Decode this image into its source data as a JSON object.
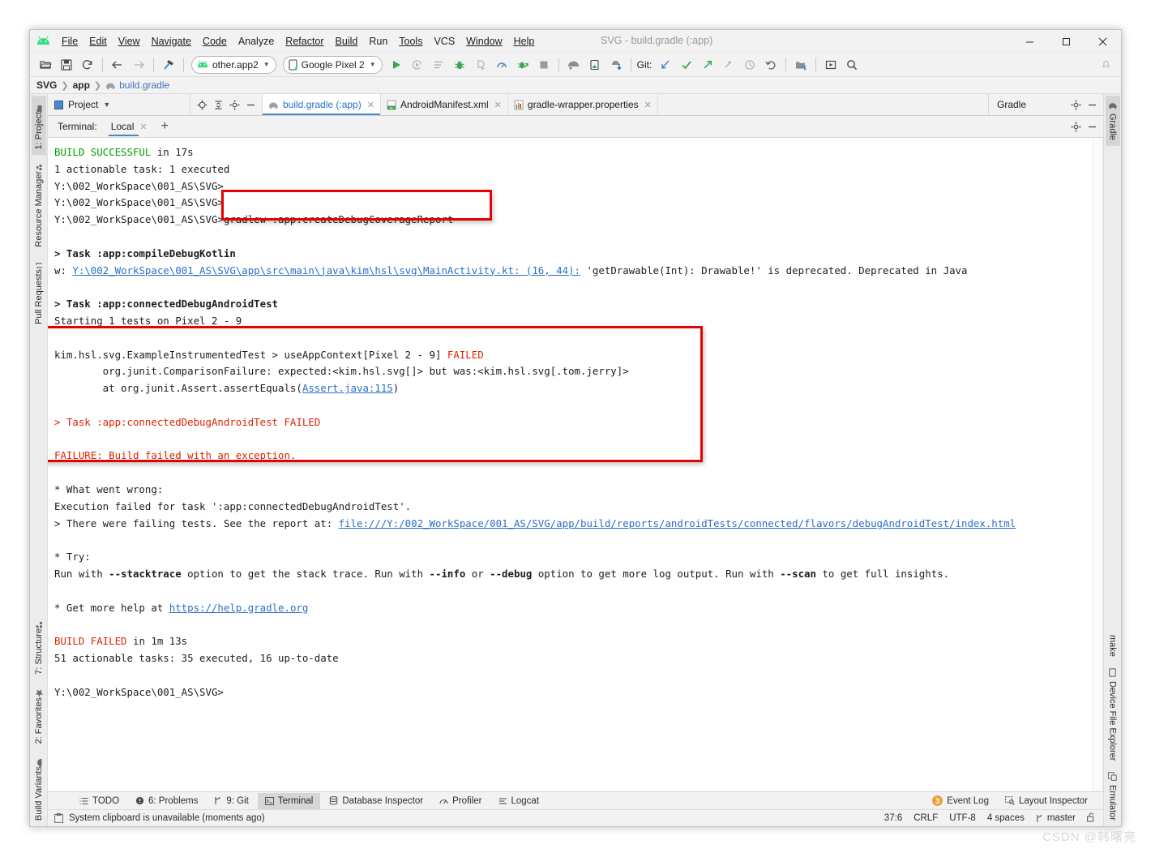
{
  "window": {
    "title": "SVG - build.gradle (:app)",
    "minimize": "–",
    "maximize": "☐",
    "close": "✕"
  },
  "menubar": {
    "items": [
      {
        "label": "File",
        "mnemonic": "F"
      },
      {
        "label": "Edit",
        "mnemonic": "E"
      },
      {
        "label": "View",
        "mnemonic": "V"
      },
      {
        "label": "Navigate",
        "mnemonic": "N"
      },
      {
        "label": "Code",
        "mnemonic": "C"
      },
      {
        "label": "Analyze",
        "mnemonic": "z"
      },
      {
        "label": "Refactor",
        "mnemonic": "R"
      },
      {
        "label": "Build",
        "mnemonic": "B"
      },
      {
        "label": "Run",
        "mnemonic": "u"
      },
      {
        "label": "Tools",
        "mnemonic": "T"
      },
      {
        "label": "VCS",
        "mnemonic": "S"
      },
      {
        "label": "Window",
        "mnemonic": "W"
      },
      {
        "label": "Help",
        "mnemonic": "H"
      }
    ]
  },
  "toolbar": {
    "module_combo": "other.app2",
    "device_combo": "Google Pixel 2",
    "git_label": "Git:",
    "icons": [
      "open-folder-icon",
      "save-all-icon",
      "sync-icon",
      "back-arrow-icon",
      "forward-arrow-icon",
      "build-hammer-icon"
    ],
    "run_icons": [
      "run-icon",
      "apply-changes-icon",
      "run-with-coverage-icon",
      "debug-icon",
      "attach-debugger-icon",
      "profiler-icon",
      "apply-code-changes-icon",
      "stop-icon"
    ],
    "device_icons": [
      "avd-manager-icon",
      "sdk-manager-icon",
      "device-file-explorer-icon"
    ],
    "git_icons": [
      "update-project-icon",
      "commit-icon",
      "push-icon",
      "revert-icon",
      "history-icon",
      "undo-icon"
    ],
    "right_icons": [
      "project-structure-icon",
      "layout-editor-icon",
      "search-everywhere-icon"
    ]
  },
  "breadcrumb": {
    "root": "SVG",
    "module": "app",
    "file": "build.gradle"
  },
  "project_panel": {
    "label": "Project",
    "caret": "▾",
    "buttons": [
      "locate-icon",
      "collapse-all-icon",
      "settings-gear-icon",
      "hide-icon"
    ]
  },
  "editor_tabs": [
    {
      "label": "build.gradle (:app)",
      "icon": "gradle-elephant-icon",
      "active": true,
      "close": "✕"
    },
    {
      "label": "AndroidManifest.xml",
      "icon": "manifest-file-icon",
      "active": false,
      "close": "✕"
    },
    {
      "label": "gradle-wrapper.properties",
      "icon": "properties-file-icon",
      "active": false,
      "close": "✕"
    }
  ],
  "gradle_panel": {
    "title": "Gradle",
    "buttons": [
      "settings-gear-icon",
      "hide-icon"
    ]
  },
  "left_stripe": {
    "top": [
      {
        "label": "1: Project",
        "icon": "project-folder-icon",
        "selected": true
      },
      {
        "label": "Resource Manager",
        "icon": "resource-manager-icon",
        "selected": false
      },
      {
        "label": "Pull Requests",
        "icon": "pull-request-icon",
        "selected": false
      }
    ],
    "bottom": [
      {
        "label": "7: Structure",
        "icon": "structure-icon",
        "selected": false
      },
      {
        "label": "2: Favorites",
        "icon": "star-icon",
        "selected": false
      },
      {
        "label": "Build Variants",
        "icon": "android-icon",
        "selected": false
      }
    ]
  },
  "right_stripe": {
    "top": [
      {
        "label": "Gradle",
        "icon": "gradle-elephant-icon",
        "selected": true
      }
    ],
    "bottom": [
      {
        "label": "make",
        "icon": "",
        "selected": false
      },
      {
        "label": "Device File Explorer",
        "icon": "device-icon",
        "selected": false
      },
      {
        "label": "Emulator",
        "icon": "emulator-icon",
        "selected": false
      }
    ]
  },
  "terminal": {
    "label": "Terminal:",
    "tab": "Local",
    "tab_close": "✕",
    "add": "+",
    "header_buttons": [
      "settings-gear-icon",
      "hide-icon"
    ],
    "lines": [
      [
        {
          "t": "BUILD SUCCESSFUL",
          "c": "g"
        },
        {
          "t": " in 17s"
        }
      ],
      [
        {
          "t": "1 actionable task: 1 executed"
        }
      ],
      [
        {
          "t": "Y:\\002_WorkSpace\\001_AS\\SVG>"
        }
      ],
      [
        {
          "t": "Y:\\002_WorkSpace\\001_AS\\SVG>"
        }
      ],
      [
        {
          "t": "Y:\\002_WorkSpace\\001_AS\\SVG>gradlew :app:createDebugCoverageReport"
        }
      ],
      [
        {
          "t": ""
        }
      ],
      [
        {
          "t": "> Task :app:compileDebugKotlin",
          "c": "b"
        }
      ],
      [
        {
          "t": "w: "
        },
        {
          "t": "Y:\\002_WorkSpace\\001_AS\\SVG\\app\\src\\main\\java\\kim\\hsl\\svg\\MainActivity.kt: (16, 44):",
          "c": "lnk"
        },
        {
          "t": " 'getDrawable(Int): Drawable!' is deprecated. Deprecated in Java"
        }
      ],
      [
        {
          "t": ""
        }
      ],
      [
        {
          "t": "> Task :app:connectedDebugAndroidTest",
          "c": "b"
        }
      ],
      [
        {
          "t": "Starting 1 tests on Pixel 2 - 9"
        }
      ],
      [
        {
          "t": ""
        }
      ],
      [
        {
          "t": "kim.hsl.svg.ExampleInstrumentedTest > useAppContext[Pixel 2 - 9] "
        },
        {
          "t": "FAILED",
          "c": "r"
        }
      ],
      [
        {
          "t": "        org.junit.ComparisonFailure: expected:<kim.hsl.svg[]> but was:<kim.hsl.svg[.tom.jerry]>"
        }
      ],
      [
        {
          "t": "        at org.junit.Assert.assertEquals("
        },
        {
          "t": "Assert.java:115",
          "c": "lnk"
        },
        {
          "t": ")"
        }
      ],
      [
        {
          "t": ""
        }
      ],
      [
        {
          "t": "> Task :app:connectedDebugAndroidTest FAILED",
          "c": "r"
        }
      ],
      [
        {
          "t": ""
        }
      ],
      [
        {
          "t": "FAILURE: Build failed with an exception.",
          "c": "r"
        }
      ],
      [
        {
          "t": ""
        }
      ],
      [
        {
          "t": "* What went wrong:"
        }
      ],
      [
        {
          "t": "Execution failed for task ':app:connectedDebugAndroidTest'."
        }
      ],
      [
        {
          "t": "> There were failing tests. See the report at: "
        },
        {
          "t": "file:///Y:/002_WorkSpace/001_AS/SVG/app/build/reports/androidTests/connected/flavors/debugAndroidTest/index.html",
          "c": "lnk"
        }
      ],
      [
        {
          "t": ""
        }
      ],
      [
        {
          "t": "* Try:"
        }
      ],
      [
        {
          "t": "Run with "
        },
        {
          "t": "--stacktrace",
          "c": "b"
        },
        {
          "t": " option to get the stack trace. Run with "
        },
        {
          "t": "--info",
          "c": "b"
        },
        {
          "t": " or "
        },
        {
          "t": "--debug",
          "c": "b"
        },
        {
          "t": " option to get more log output. Run with "
        },
        {
          "t": "--scan",
          "c": "b"
        },
        {
          "t": " to get full insights."
        }
      ],
      [
        {
          "t": ""
        }
      ],
      [
        {
          "t": "* Get more help at "
        },
        {
          "t": "https://help.gradle.org",
          "c": "lnk"
        }
      ],
      [
        {
          "t": ""
        }
      ],
      [
        {
          "t": "BUILD FAILED",
          "c": "r"
        },
        {
          "t": " in 1m 13s"
        }
      ],
      [
        {
          "t": "51 actionable tasks: 35 executed, 16 up-to-date"
        }
      ],
      [
        {
          "t": ""
        }
      ],
      [
        {
          "t": "Y:\\002_WorkSpace\\001_AS\\SVG>"
        }
      ]
    ]
  },
  "bottom_bar": {
    "items": [
      {
        "label": "TODO",
        "icon": "todo-list-icon",
        "selected": false,
        "mnemonic": ""
      },
      {
        "label": "6: Problems",
        "icon": "problems-warning-icon",
        "selected": false,
        "mnemonic": "6"
      },
      {
        "label": "9: Git",
        "icon": "git-branch-icon",
        "selected": false,
        "mnemonic": "9"
      },
      {
        "label": "Terminal",
        "icon": "terminal-icon",
        "selected": true,
        "mnemonic": ""
      },
      {
        "label": "Database Inspector",
        "icon": "database-icon",
        "selected": false,
        "mnemonic": ""
      },
      {
        "label": "Profiler",
        "icon": "profiler-icon",
        "selected": false,
        "mnemonic": ""
      },
      {
        "label": "Logcat",
        "icon": "logcat-icon",
        "selected": false,
        "mnemonic": ""
      }
    ],
    "event_log": {
      "label": "Event Log",
      "count": "3"
    },
    "layout_inspector": {
      "label": "Layout Inspector",
      "icon": "layout-inspector-icon"
    }
  },
  "statusbar": {
    "message": "System clipboard is unavailable (moments ago)",
    "message_icon": "clipboard-icon",
    "caret_position": "37:6",
    "line_separator": "CRLF",
    "encoding": "UTF-8",
    "indent": "4 spaces",
    "branch": "master",
    "branch_icon": "git-branch-icon",
    "lock_icon": "lock-open-icon"
  },
  "watermark": "CSDN @韩曙亮",
  "colors": {
    "accent": "#4a88c7",
    "success": "#00a000",
    "error": "#dd2200",
    "link": "#2a6fc7",
    "highlight_box": "#e60000",
    "chrome": "#f2f2f2"
  }
}
